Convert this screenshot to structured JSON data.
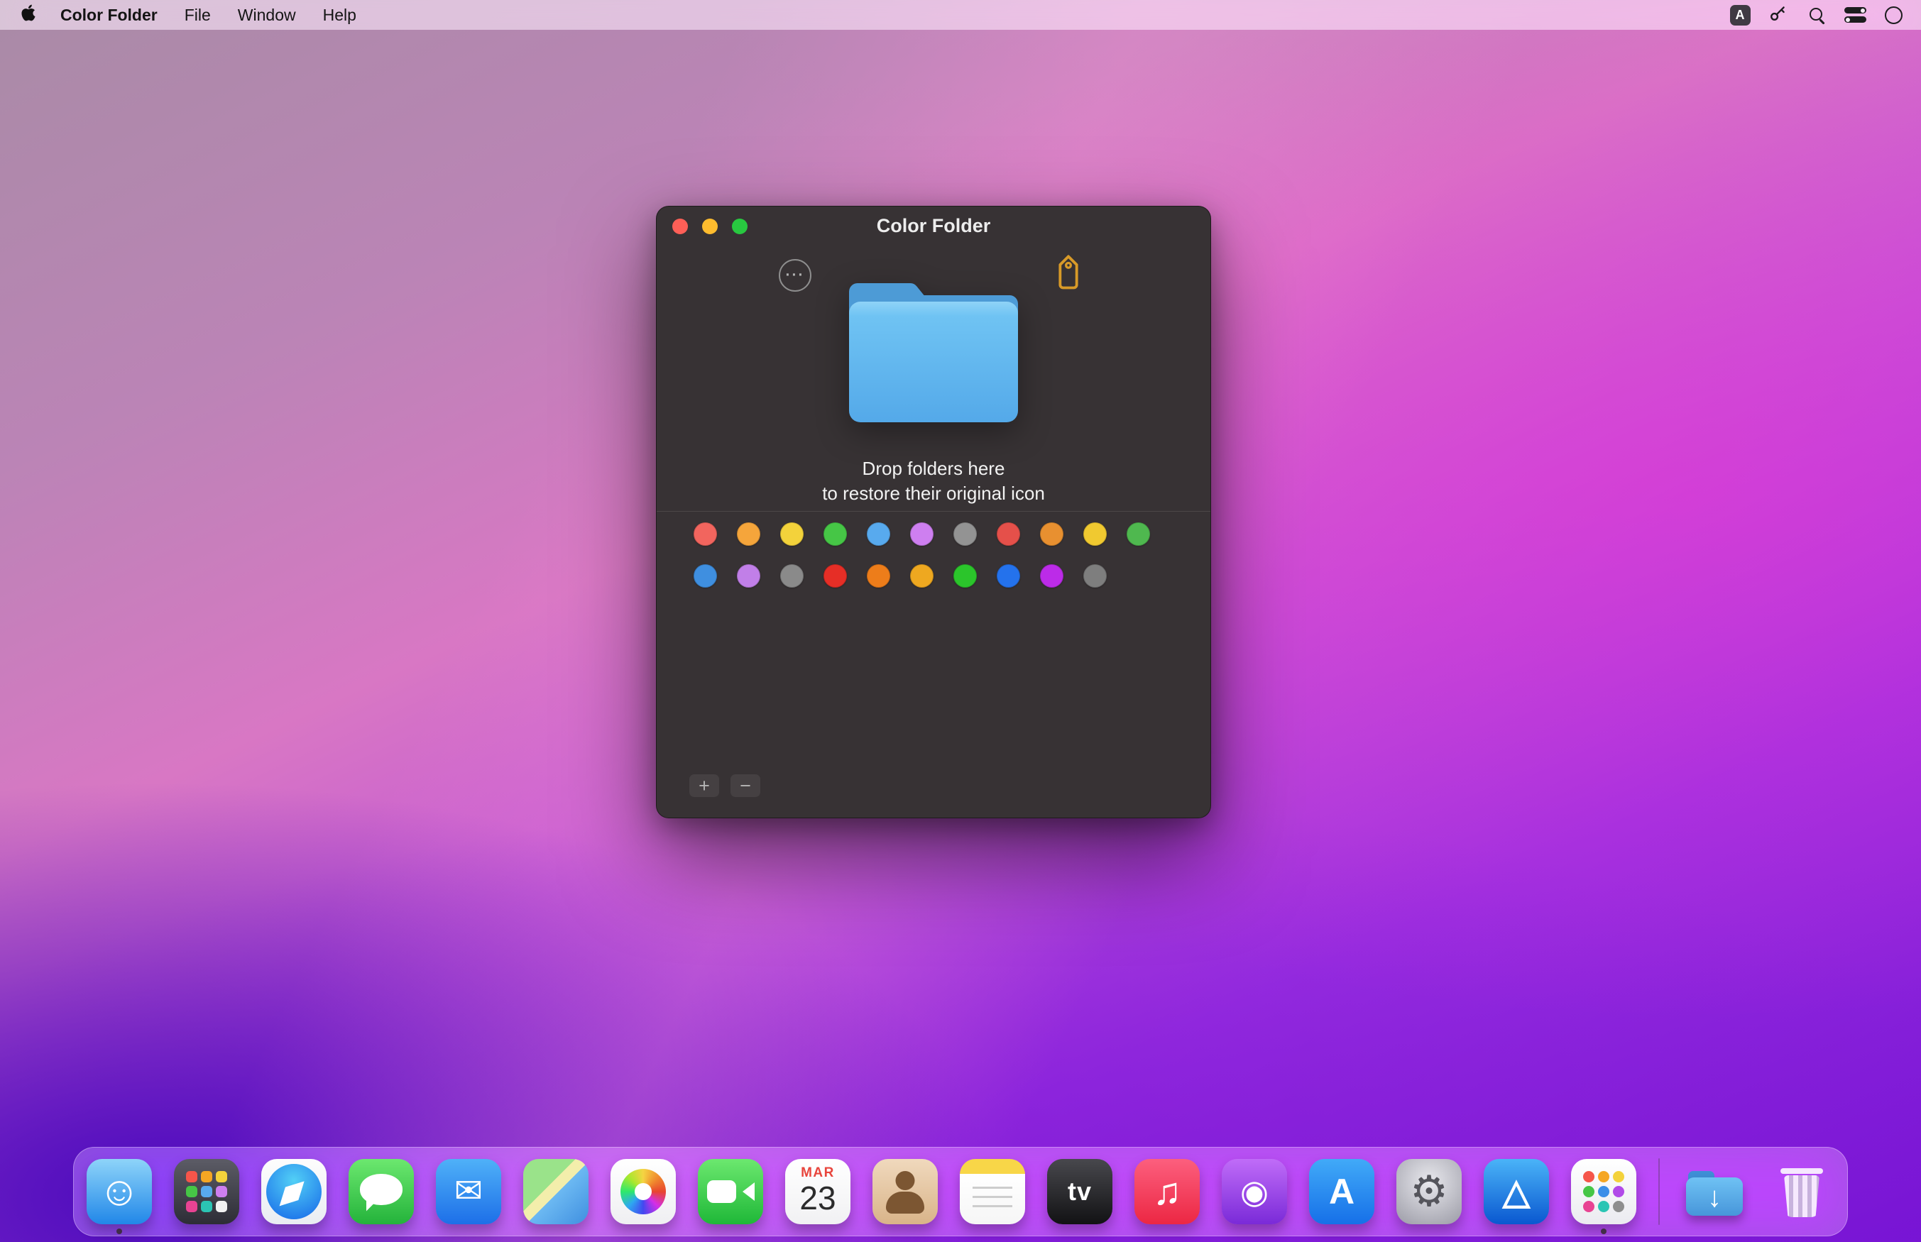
{
  "menu_bar": {
    "app_name": "Color Folder",
    "menus": [
      "File",
      "Window",
      "Help"
    ],
    "status": {
      "input_source": "A"
    }
  },
  "window": {
    "title": "Color Folder",
    "ellipsis_glyph": "···",
    "drop_line1": "Drop folders here",
    "drop_line2": "to restore their original icon",
    "add_label": "+",
    "remove_label": "−",
    "swatch_rows": [
      [
        "#F2655E",
        "#F5A53B",
        "#F3D23B",
        "#46C646",
        "#58AAEE",
        "#CE7FF0",
        "#939393",
        "#E5504A",
        "#E89030",
        "#F0C930",
        "#4FB84F"
      ],
      [
        "#3F8FE0",
        "#C17FE8",
        "#8A8A8A",
        "#E62E26",
        "#ED7D1A",
        "#EEA820",
        "#2BC52B",
        "#2472EC",
        "#BC2BE8",
        "#7E7E7E"
      ]
    ],
    "folder_colors": {
      "tab": "#4d9bd6",
      "body_top": "#8fd3f7",
      "body_bottom": "#54a9e9"
    },
    "tag_icon_color": "#d89a28"
  },
  "dock": {
    "items": [
      {
        "name": "finder",
        "label": "Finder",
        "bg": "linear-gradient(180deg,#8ed4f9 0%,#2187e8 100%)",
        "glyph": "☺",
        "glyph_color": "#ffffff",
        "running": true
      },
      {
        "name": "launchpad",
        "label": "Launchpad",
        "type": "dots",
        "bg": "linear-gradient(180deg,#5c5c66 0%,#2d2d36 100%)",
        "dots": [
          "#f5554a",
          "#f5a623",
          "#f3d23b",
          "#46c646",
          "#58aaee",
          "#ce7ff0",
          "#e84393",
          "#2bc5b4",
          "#f2f2f2"
        ]
      },
      {
        "name": "safari",
        "label": "Safari",
        "bg": "linear-gradient(180deg,#fdfdfd 0%,#e9edf2 100%)",
        "glyph": "◆",
        "glyph_color": "#ffffff"
      },
      {
        "name": "messages",
        "label": "Messages",
        "bg": "linear-gradient(180deg,#6ce86f 0%,#24b33b 100%)"
      },
      {
        "name": "mail",
        "label": "Mail",
        "bg": "linear-gradient(180deg,#4fb1f8 0%,#1d6fe8 100%)",
        "glyph": "✉",
        "glyph_color": "#ffffff"
      },
      {
        "name": "maps",
        "label": "Maps",
        "bg": "linear-gradient(135deg,#9ae38a 0%,#9ae38a 40%,#f3eeab 40%,#f3eeab 52%,#6cb9f2 52%,#3f8fe0 100%)"
      },
      {
        "name": "photos",
        "label": "Photos",
        "bg": "linear-gradient(180deg,#ffffff 0%,#efeff2 100%)"
      },
      {
        "name": "facetime",
        "label": "FaceTime",
        "bg": "linear-gradient(180deg,#6ce86f 0%,#1fb838 100%)"
      },
      {
        "name": "calendar",
        "label": "Calendar",
        "type": "calendar",
        "bg": "linear-gradient(180deg,#ffffff 0%,#f1f1f3 100%)",
        "month": "MAR",
        "day": "23"
      },
      {
        "name": "contacts",
        "label": "Contacts",
        "bg": "linear-gradient(180deg,#f0d9bd 0%,#d9b489 100%)"
      },
      {
        "name": "notes",
        "label": "Notes",
        "bg": "linear-gradient(180deg,#f8d648 0%,#f8d648 23%,#ffffff 23%,#f6f6f6 100%)"
      },
      {
        "name": "appletv",
        "label": "TV",
        "bg": "linear-gradient(180deg,#48484d 0%,#121214 100%)",
        "glyph": "tv",
        "glyph_color": "#ffffff"
      },
      {
        "name": "music",
        "label": "Music",
        "bg": "linear-gradient(180deg,#fc5f7e 0%,#ec2743 100%)",
        "glyph": "♫",
        "glyph_color": "#ffffff"
      },
      {
        "name": "podcasts",
        "label": "Podcasts",
        "bg": "linear-gradient(180deg,#c06cf8 0%,#7a2ad8 100%)",
        "glyph": "◉",
        "glyph_color": "#ffffff"
      },
      {
        "name": "appstore",
        "label": "App Store",
        "bg": "linear-gradient(180deg,#41aaf8 0%,#1670e8 100%)",
        "glyph": "A",
        "glyph_color": "#ffffff"
      },
      {
        "name": "settings",
        "label": "System Preferences",
        "bg": "radial-gradient(circle at 50% 35%,#e9e9ee 0%,#9b9ba6 100%)",
        "glyph": "⚙",
        "glyph_color": "#55555c"
      },
      {
        "name": "triangle-app",
        "label": "Graph App",
        "bg": "linear-gradient(180deg,#4ab4f8 0%,#0a58d0 100%)",
        "glyph": "△",
        "glyph_color": "#ffffff"
      },
      {
        "name": "colorfolder-app",
        "label": "Color Folder",
        "type": "dots",
        "bg": "linear-gradient(180deg,#ffffff 0%,#ebebf0 100%)",
        "dots": [
          "#f5554a",
          "#f5a623",
          "#f3d23b",
          "#46c646",
          "#3b8ee8",
          "#b14ae8",
          "#e84393",
          "#2bc5b4",
          "#8e8e8e"
        ],
        "running": true
      },
      {
        "type": "separator"
      },
      {
        "name": "downloads",
        "label": "Downloads",
        "type": "downloads",
        "glyph": "↓",
        "glyph_color": "#ffffff"
      },
      {
        "name": "trash",
        "label": "Trash",
        "type": "trash"
      }
    ]
  }
}
